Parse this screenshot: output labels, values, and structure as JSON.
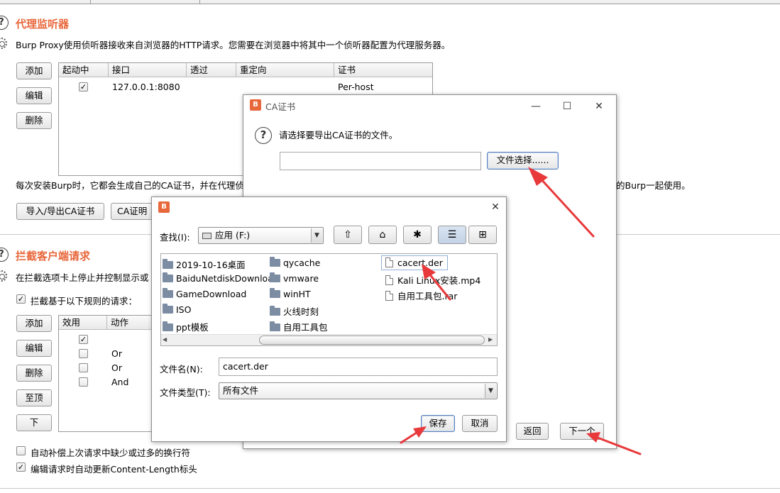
{
  "proxy": {
    "title": "代理监听器",
    "desc": "Burp Proxy使用侦听器接收来自浏览器的HTTP请求。您需要在浏览器中将其中一个侦听器配置为代理服务器。",
    "add": "添加",
    "edit": "编辑",
    "remove": "删除",
    "columns": [
      "起动中",
      "接口",
      "透过",
      "重定向",
      "证书"
    ],
    "rows": [
      {
        "running": "✓",
        "interface": "127.0.0.1:8080",
        "invisible": "",
        "redirect": "",
        "cert": "Per-host"
      }
    ],
    "ca_desc_left": "每次安装Burp时，它都会生成自己的CA证书，并在代理侦",
    "ca_desc_right": "的Burp一起使用。",
    "import_export": "导入/导出CA证书",
    "regen_partial": "CA证明"
  },
  "intercept": {
    "title": "拦截客户端请求",
    "desc": "在拦截选项卡上停止并控制显示或",
    "rule_checkbox": "拦截基于以下规则的请求：",
    "add": "添加",
    "edit": "编辑",
    "remove": "删除",
    "up": "至顶",
    "down": "下",
    "columns": [
      "效用",
      "动作"
    ],
    "rows": [
      {
        "enabled": "✓",
        "op": ""
      },
      {
        "enabled": "",
        "op": "Or"
      },
      {
        "enabled": "",
        "op": "Or"
      },
      {
        "enabled": "",
        "op": "And"
      }
    ],
    "auto_fix": "自动补偿上次请求中缺少或过多的换行符",
    "auto_update": "编辑请求时自动更新Content-Length标头"
  },
  "ca_dialog": {
    "title": "CA证书",
    "prompt": "请选择要导出CA证书的文件。",
    "path_value": "",
    "choose_file": "文件选择......",
    "back": "返回",
    "next": "下一个"
  },
  "file_dialog": {
    "look_in_label": "查找(I):",
    "look_in_value": "应用 (F:)",
    "col1": [
      "2019-10-16桌面",
      "BaiduNetdiskDownload",
      "GameDownload",
      "ISO",
      "ppt模板"
    ],
    "col2": [
      "qycache",
      "vmware",
      "winHT",
      "火线时刻",
      "自用工具包"
    ],
    "col3": [
      "cacert.der",
      "Kali Linux安装.mp4",
      "自用工具包.rar"
    ],
    "filename_label": "文件名(N):",
    "filename_value": "cacert.der",
    "filetype_label": "文件类型(T):",
    "filetype_value": "所有文件",
    "save": "保存",
    "cancel": "取消"
  },
  "colors": {
    "accent": "#e8673b",
    "arrow": "#e8393b"
  }
}
